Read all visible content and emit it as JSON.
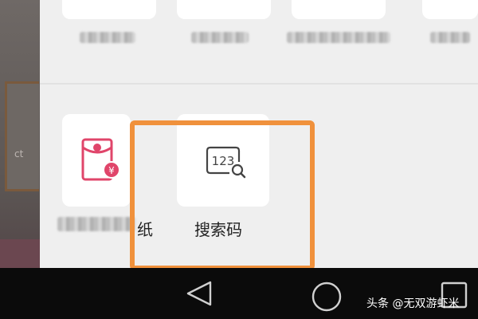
{
  "apps": {
    "search_code": {
      "label": "搜索码",
      "icon_text": "123"
    },
    "red_envelope": {
      "label_visible_part": "纸"
    }
  },
  "watermark": "头条 @无双游虾米",
  "colors": {
    "highlight": "#f0913c",
    "sheet_bg": "#efefef",
    "nav_bg": "#0b0b0b",
    "red_envelope": "#e0456a"
  },
  "icons": [
    "red-envelope-icon",
    "search-code-icon",
    "back-icon",
    "home-icon",
    "recents-icon"
  ]
}
